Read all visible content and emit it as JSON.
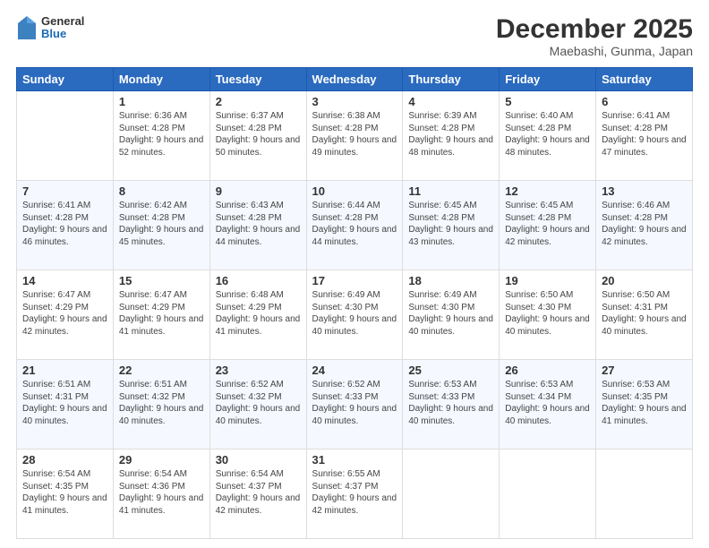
{
  "header": {
    "logo": {
      "general": "General",
      "blue": "Blue"
    },
    "title": "December 2025",
    "subtitle": "Maebashi, Gunma, Japan"
  },
  "calendar": {
    "columns": [
      "Sunday",
      "Monday",
      "Tuesday",
      "Wednesday",
      "Thursday",
      "Friday",
      "Saturday"
    ],
    "weeks": [
      [
        {
          "day": "",
          "sunrise": "",
          "sunset": "",
          "daylight": ""
        },
        {
          "day": "1",
          "sunrise": "Sunrise: 6:36 AM",
          "sunset": "Sunset: 4:28 PM",
          "daylight": "Daylight: 9 hours and 52 minutes."
        },
        {
          "day": "2",
          "sunrise": "Sunrise: 6:37 AM",
          "sunset": "Sunset: 4:28 PM",
          "daylight": "Daylight: 9 hours and 50 minutes."
        },
        {
          "day": "3",
          "sunrise": "Sunrise: 6:38 AM",
          "sunset": "Sunset: 4:28 PM",
          "daylight": "Daylight: 9 hours and 49 minutes."
        },
        {
          "day": "4",
          "sunrise": "Sunrise: 6:39 AM",
          "sunset": "Sunset: 4:28 PM",
          "daylight": "Daylight: 9 hours and 48 minutes."
        },
        {
          "day": "5",
          "sunrise": "Sunrise: 6:40 AM",
          "sunset": "Sunset: 4:28 PM",
          "daylight": "Daylight: 9 hours and 48 minutes."
        },
        {
          "day": "6",
          "sunrise": "Sunrise: 6:41 AM",
          "sunset": "Sunset: 4:28 PM",
          "daylight": "Daylight: 9 hours and 47 minutes."
        }
      ],
      [
        {
          "day": "7",
          "sunrise": "Sunrise: 6:41 AM",
          "sunset": "Sunset: 4:28 PM",
          "daylight": "Daylight: 9 hours and 46 minutes."
        },
        {
          "day": "8",
          "sunrise": "Sunrise: 6:42 AM",
          "sunset": "Sunset: 4:28 PM",
          "daylight": "Daylight: 9 hours and 45 minutes."
        },
        {
          "day": "9",
          "sunrise": "Sunrise: 6:43 AM",
          "sunset": "Sunset: 4:28 PM",
          "daylight": "Daylight: 9 hours and 44 minutes."
        },
        {
          "day": "10",
          "sunrise": "Sunrise: 6:44 AM",
          "sunset": "Sunset: 4:28 PM",
          "daylight": "Daylight: 9 hours and 44 minutes."
        },
        {
          "day": "11",
          "sunrise": "Sunrise: 6:45 AM",
          "sunset": "Sunset: 4:28 PM",
          "daylight": "Daylight: 9 hours and 43 minutes."
        },
        {
          "day": "12",
          "sunrise": "Sunrise: 6:45 AM",
          "sunset": "Sunset: 4:28 PM",
          "daylight": "Daylight: 9 hours and 42 minutes."
        },
        {
          "day": "13",
          "sunrise": "Sunrise: 6:46 AM",
          "sunset": "Sunset: 4:28 PM",
          "daylight": "Daylight: 9 hours and 42 minutes."
        }
      ],
      [
        {
          "day": "14",
          "sunrise": "Sunrise: 6:47 AM",
          "sunset": "Sunset: 4:29 PM",
          "daylight": "Daylight: 9 hours and 42 minutes."
        },
        {
          "day": "15",
          "sunrise": "Sunrise: 6:47 AM",
          "sunset": "Sunset: 4:29 PM",
          "daylight": "Daylight: 9 hours and 41 minutes."
        },
        {
          "day": "16",
          "sunrise": "Sunrise: 6:48 AM",
          "sunset": "Sunset: 4:29 PM",
          "daylight": "Daylight: 9 hours and 41 minutes."
        },
        {
          "day": "17",
          "sunrise": "Sunrise: 6:49 AM",
          "sunset": "Sunset: 4:30 PM",
          "daylight": "Daylight: 9 hours and 40 minutes."
        },
        {
          "day": "18",
          "sunrise": "Sunrise: 6:49 AM",
          "sunset": "Sunset: 4:30 PM",
          "daylight": "Daylight: 9 hours and 40 minutes."
        },
        {
          "day": "19",
          "sunrise": "Sunrise: 6:50 AM",
          "sunset": "Sunset: 4:30 PM",
          "daylight": "Daylight: 9 hours and 40 minutes."
        },
        {
          "day": "20",
          "sunrise": "Sunrise: 6:50 AM",
          "sunset": "Sunset: 4:31 PM",
          "daylight": "Daylight: 9 hours and 40 minutes."
        }
      ],
      [
        {
          "day": "21",
          "sunrise": "Sunrise: 6:51 AM",
          "sunset": "Sunset: 4:31 PM",
          "daylight": "Daylight: 9 hours and 40 minutes."
        },
        {
          "day": "22",
          "sunrise": "Sunrise: 6:51 AM",
          "sunset": "Sunset: 4:32 PM",
          "daylight": "Daylight: 9 hours and 40 minutes."
        },
        {
          "day": "23",
          "sunrise": "Sunrise: 6:52 AM",
          "sunset": "Sunset: 4:32 PM",
          "daylight": "Daylight: 9 hours and 40 minutes."
        },
        {
          "day": "24",
          "sunrise": "Sunrise: 6:52 AM",
          "sunset": "Sunset: 4:33 PM",
          "daylight": "Daylight: 9 hours and 40 minutes."
        },
        {
          "day": "25",
          "sunrise": "Sunrise: 6:53 AM",
          "sunset": "Sunset: 4:33 PM",
          "daylight": "Daylight: 9 hours and 40 minutes."
        },
        {
          "day": "26",
          "sunrise": "Sunrise: 6:53 AM",
          "sunset": "Sunset: 4:34 PM",
          "daylight": "Daylight: 9 hours and 40 minutes."
        },
        {
          "day": "27",
          "sunrise": "Sunrise: 6:53 AM",
          "sunset": "Sunset: 4:35 PM",
          "daylight": "Daylight: 9 hours and 41 minutes."
        }
      ],
      [
        {
          "day": "28",
          "sunrise": "Sunrise: 6:54 AM",
          "sunset": "Sunset: 4:35 PM",
          "daylight": "Daylight: 9 hours and 41 minutes."
        },
        {
          "day": "29",
          "sunrise": "Sunrise: 6:54 AM",
          "sunset": "Sunset: 4:36 PM",
          "daylight": "Daylight: 9 hours and 41 minutes."
        },
        {
          "day": "30",
          "sunrise": "Sunrise: 6:54 AM",
          "sunset": "Sunset: 4:37 PM",
          "daylight": "Daylight: 9 hours and 42 minutes."
        },
        {
          "day": "31",
          "sunrise": "Sunrise: 6:55 AM",
          "sunset": "Sunset: 4:37 PM",
          "daylight": "Daylight: 9 hours and 42 minutes."
        },
        {
          "day": "",
          "sunrise": "",
          "sunset": "",
          "daylight": ""
        },
        {
          "day": "",
          "sunrise": "",
          "sunset": "",
          "daylight": ""
        },
        {
          "day": "",
          "sunrise": "",
          "sunset": "",
          "daylight": ""
        }
      ]
    ]
  }
}
